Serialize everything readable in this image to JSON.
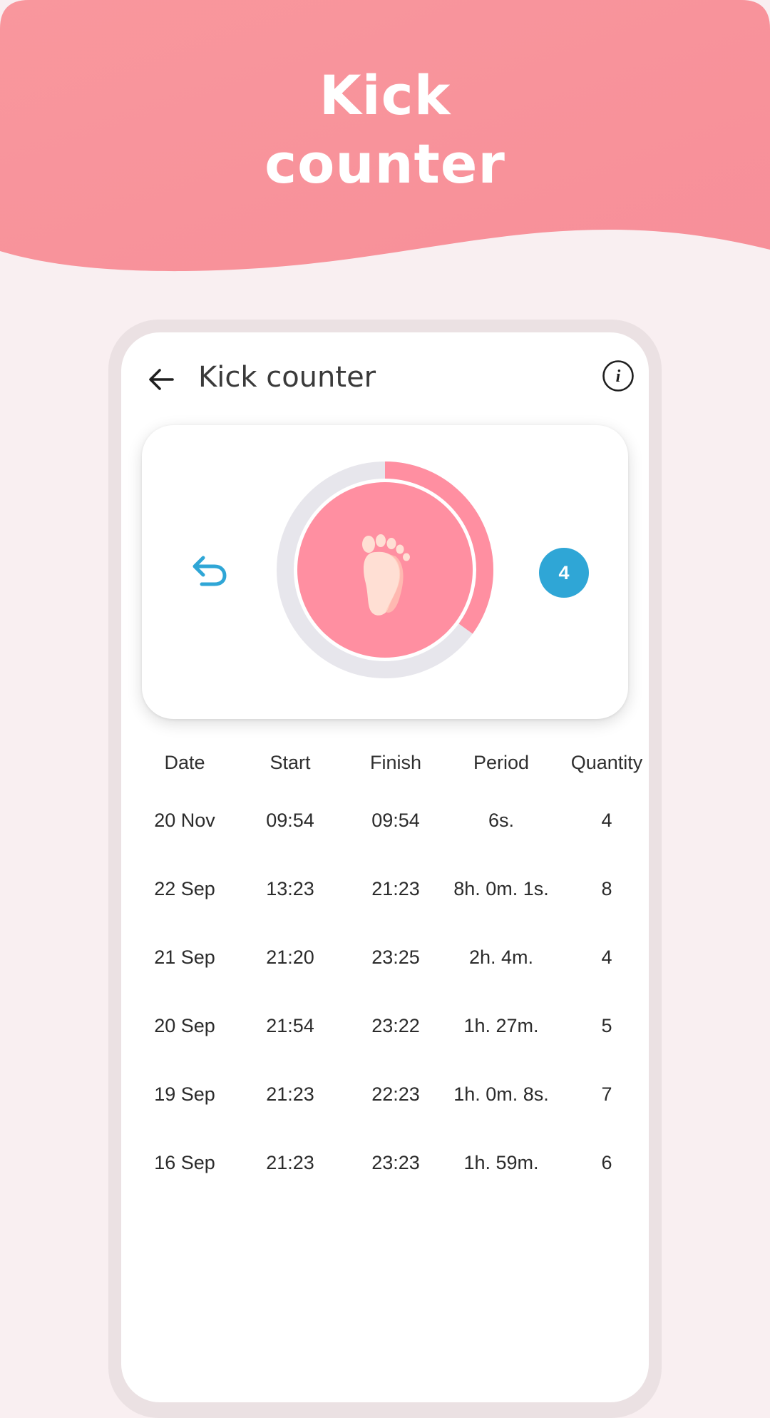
{
  "banner": {
    "title_line1": "Kick",
    "title_line2": "counter",
    "color": "#f8949c"
  },
  "app_bar": {
    "title": "Kick counter",
    "back_icon": "arrow-left-icon",
    "info_icon": "info-icon"
  },
  "counter": {
    "undo_icon": "undo-icon",
    "kick_icon": "foot-icon",
    "count": "4",
    "progress": 0.35,
    "accent_color": "#ff8fa1",
    "badge_color": "#2fa6d6"
  },
  "history": {
    "headers": [
      "Date",
      "Start",
      "Finish",
      "Period",
      "Quantity"
    ],
    "rows": [
      [
        "20 Nov",
        "09:54",
        "09:54",
        "6s.",
        "4"
      ],
      [
        "22 Sep",
        "13:23",
        "21:23",
        "8h. 0m. 1s.",
        "8"
      ],
      [
        "21 Sep",
        "21:20",
        "23:25",
        "2h. 4m.",
        "4"
      ],
      [
        "20 Sep",
        "21:54",
        "23:22",
        "1h. 27m.",
        "5"
      ],
      [
        "19 Sep",
        "21:23",
        "22:23",
        "1h. 0m. 8s.",
        "7"
      ],
      [
        "16 Sep",
        "21:23",
        "23:23",
        "1h. 59m.",
        "6"
      ]
    ]
  }
}
